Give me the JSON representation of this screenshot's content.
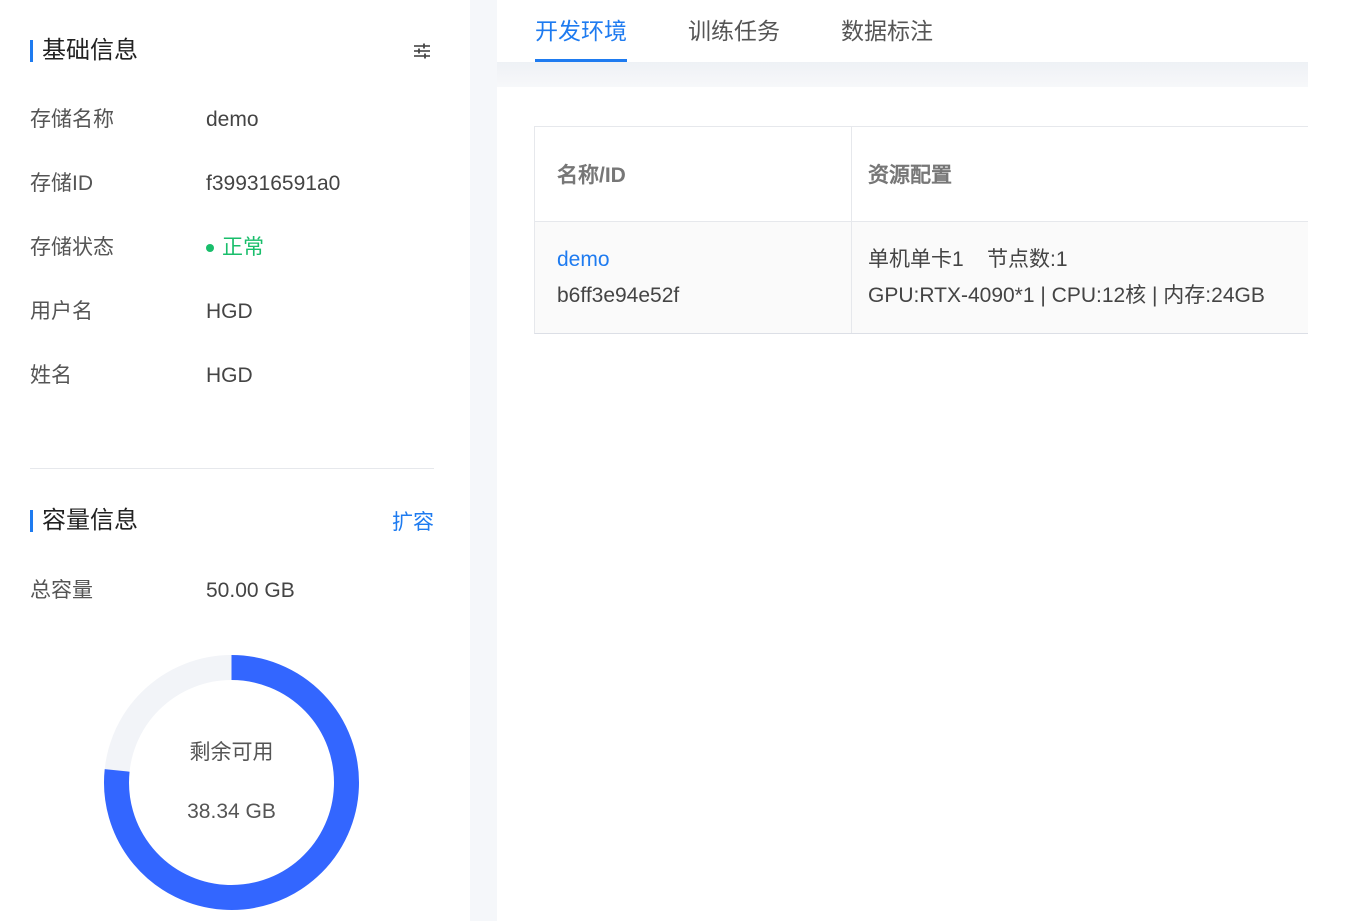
{
  "basic_info": {
    "title": "基础信息",
    "fields": [
      {
        "label": "存储名称",
        "value": "demo"
      },
      {
        "label": "存储ID",
        "value": "f399316591a0"
      },
      {
        "label": "存储状态",
        "value": "正常"
      },
      {
        "label": "用户名",
        "value": "HGD"
      },
      {
        "label": "姓名",
        "value": "HGD"
      }
    ]
  },
  "capacity": {
    "title": "容量信息",
    "expand_label": "扩容",
    "total_label": "总容量",
    "total_value": "50.00 GB",
    "remaining_label": "剩余可用",
    "remaining_value": "38.34 GB",
    "remaining_fraction": 0.7668,
    "color_used": "#f2f4f8",
    "color_remaining": "#3366ff"
  },
  "tabs": [
    {
      "label": "开发环境",
      "active": true
    },
    {
      "label": "训练任务",
      "active": false
    },
    {
      "label": "数据标注",
      "active": false
    }
  ],
  "table": {
    "columns": [
      "名称/ID",
      "资源配置"
    ],
    "rows": [
      {
        "name": "demo",
        "id": "b6ff3e94e52f",
        "config_line1": "单机单卡1    节点数:1",
        "config_line2": "GPU:RTX-4090*1 | CPU:12核 | 内存:24GB"
      }
    ]
  },
  "colors": {
    "accent": "#1e7bf0",
    "status_ok": "#19be6b"
  }
}
